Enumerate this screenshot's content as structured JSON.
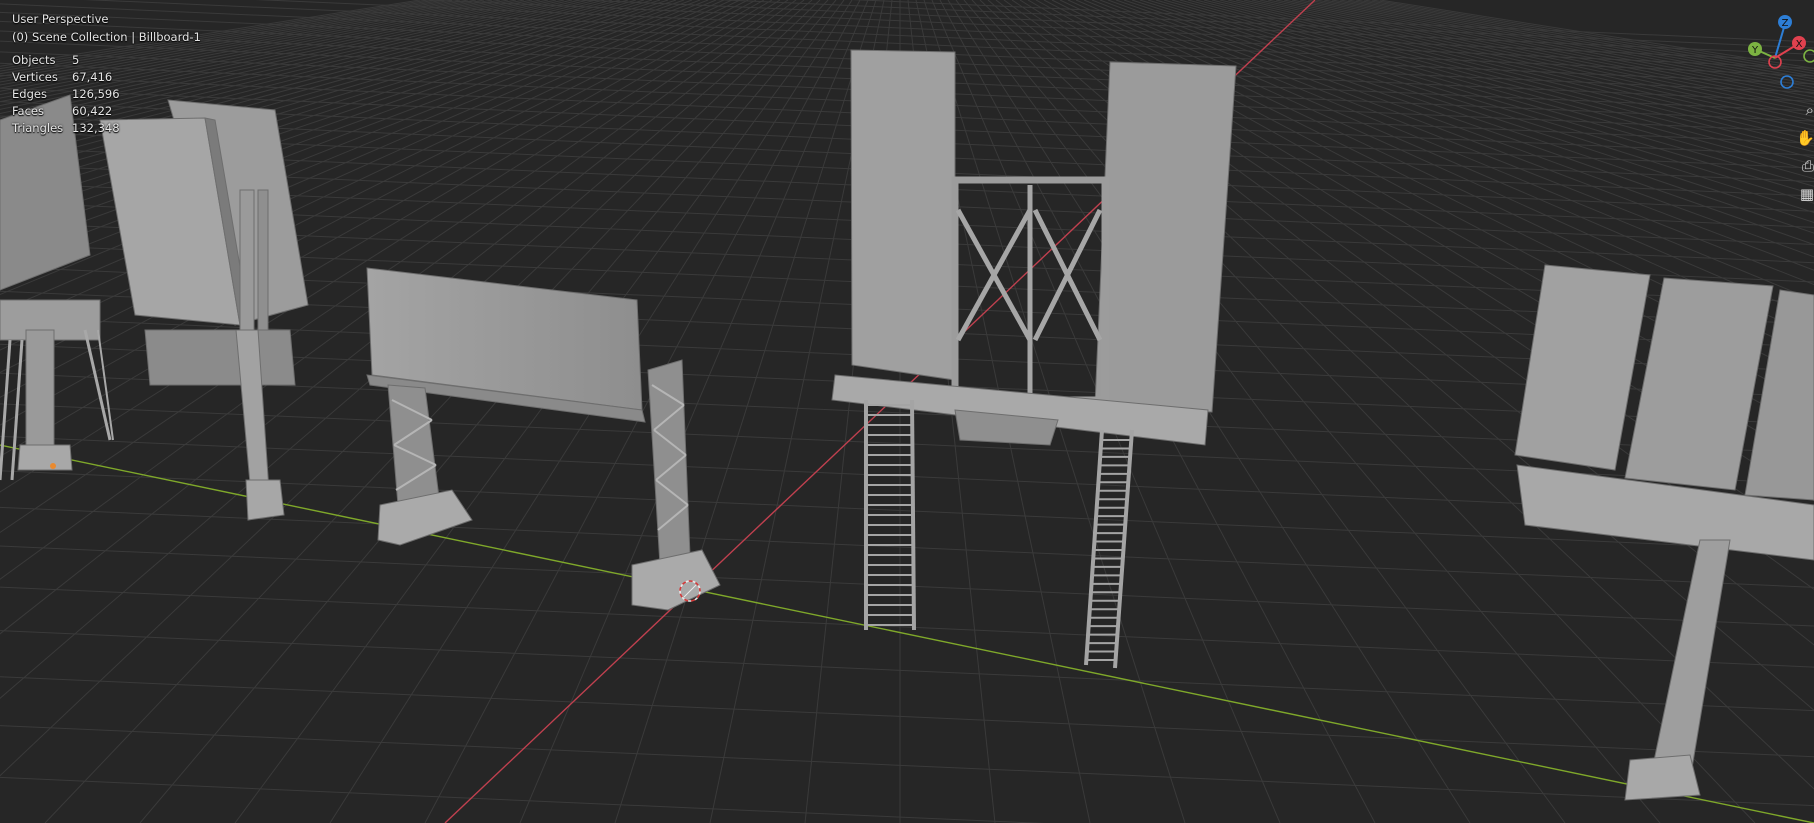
{
  "viewport": {
    "perspective": "User Perspective",
    "collection": "(0) Scene Collection | Billboard-1",
    "background_color": "#262626",
    "grid_color": "#3a3a3a",
    "x_axis_color": "#c0404f",
    "y_axis_color": "#7fa82a",
    "model_color": "#9a9a9a"
  },
  "stats": [
    {
      "label": "Objects",
      "value": "5"
    },
    {
      "label": "Vertices",
      "value": "67,416"
    },
    {
      "label": "Edges",
      "value": "126,596"
    },
    {
      "label": "Faces",
      "value": "60,422"
    },
    {
      "label": "Triangles",
      "value": "132,348"
    }
  ],
  "gizmo": {
    "z_label": "Z",
    "y_label": "Y",
    "x_label": "X",
    "z_color": "#2d7ed6",
    "y_color": "#7cb342",
    "x_color": "#e0414f"
  },
  "nav_tools": [
    {
      "icon": "zoom-icon",
      "glyph": "⌕"
    },
    {
      "icon": "hand-pan-icon",
      "glyph": "✋"
    },
    {
      "icon": "camera-icon",
      "glyph": "⎙"
    },
    {
      "icon": "grid-view-icon",
      "glyph": "▦"
    }
  ]
}
